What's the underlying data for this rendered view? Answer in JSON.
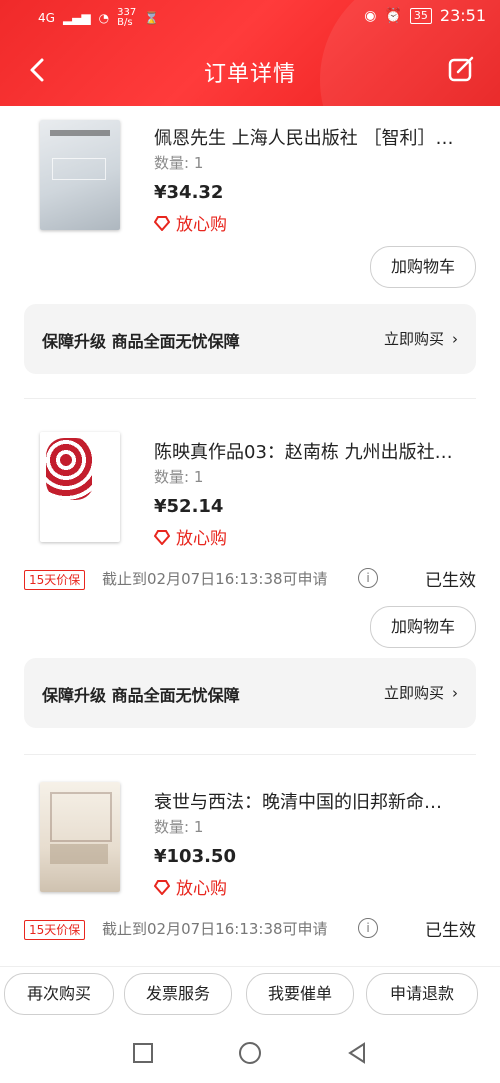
{
  "status": {
    "network": "4G",
    "speed": "337\nB/s",
    "battery": "35",
    "time": "23:51"
  },
  "header": {
    "title": "订单详情"
  },
  "items": [
    {
      "name": "佩恩先生 上海人民出版社 ［智利］…",
      "qty_label": "数量: 1",
      "price": "¥34.32",
      "assure": "放心购",
      "add_cart": "加购物车"
    },
    {
      "name": "陈映真作品03：赵南栋  九州出版社…",
      "qty_label": "数量: 1",
      "price": "¥52.14",
      "assure": "放心购",
      "badge": "15天价保",
      "deadline": "截止到02月07日16:13:38可申请",
      "status": "已生效",
      "add_cart": "加购物车"
    },
    {
      "name": "衰世与西法：晚清中国的旧邦新命…",
      "qty_label": "数量: 1",
      "price": "¥103.50",
      "assure": "放心购",
      "badge": "15天价保",
      "deadline": "截止到02月07日16:13:38可申请",
      "status": "已生效"
    }
  ],
  "guarantee": {
    "title": "保障升级  商品全面无忧保障",
    "action": "立即购买"
  },
  "footer": {
    "btns": [
      "再次购买",
      "发票服务",
      "我要催单",
      "申请退款"
    ]
  },
  "colors": {
    "accent": "#e8261e",
    "header": "#f02a2a"
  },
  "icons": {
    "back": "back-arrow-icon",
    "edit": "edit-icon",
    "assure": "heart-diamond-icon"
  }
}
